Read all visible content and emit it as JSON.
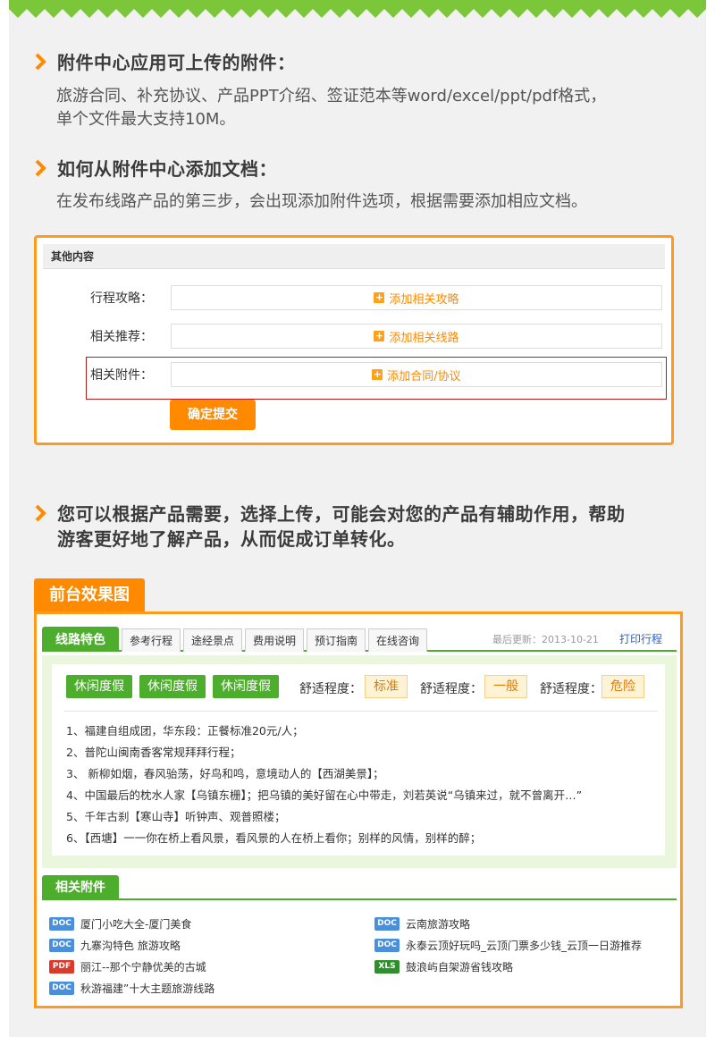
{
  "sections": [
    {
      "title": "附件中心应用可上传的附件：",
      "body": [
        "旅游合同、补充协议、产品PPT介绍、签证范本等word/excel/ppt/pdf格式，",
        "单个文件最大支持10M。"
      ]
    },
    {
      "title": "如何从附件中心添加文档：",
      "body": [
        "在发布线路产品的第三步，会出现添加附件选项，根据需要添加相应文档。"
      ]
    },
    {
      "title_lines": [
        "您可以根据产品需要，选择上传，可能会对您的产品有辅助作用，帮助",
        "游客更好地了解产品，从而促成订单转化。"
      ]
    }
  ],
  "form": {
    "header": "其他内容",
    "rows": [
      {
        "label": "行程攻略：",
        "action": "添加相关攻略"
      },
      {
        "label": "相关推荐：",
        "action": "添加相关线路"
      },
      {
        "label": "相关附件：",
        "action": "添加合同/协议"
      }
    ],
    "submit": "确定提交"
  },
  "preview": {
    "tag": "前台效果图",
    "tabs": [
      "线路特色",
      "参考行程",
      "途经景点",
      "费用说明",
      "预订指南",
      "在线咨询"
    ],
    "updated": "最后更新：2013-10-21",
    "print": "打印行程",
    "features": [
      "休闲度假",
      "休闲度假",
      "休闲度假"
    ],
    "comfort": [
      {
        "label": "舒适程度：",
        "value": "标准"
      },
      {
        "label": "舒适程度：",
        "value": "一般"
      },
      {
        "label": "舒适程度：",
        "value": "危险"
      }
    ],
    "itinerary": [
      "1、福建自组成团，华东段：正餐标准20元/人；",
      "2、普陀山闽南香客常规拜拜行程；",
      "3、 新柳如烟，春风骀荡，好鸟和鸣，意境动人的【西湖美景】；",
      "4、中国最后的枕水人家【乌镇东栅】；把乌镇的美好留在心中带走，刘若英说“乌镇来过，就不曾离开…”",
      "5、千年古刹【寒山寺】听钟声、观普照楼；",
      "6、【西塘】一一你在桥上看风景，看风景的人在桥上看你；别样的风情，别样的醉；"
    ],
    "attachments_title": "相关附件",
    "attachments": [
      {
        "type": "DOC",
        "name": "厦门小吃大全-厦门美食"
      },
      {
        "type": "DOC",
        "name": "云南旅游攻略"
      },
      {
        "type": "DOC",
        "name": "九寨沟特色 旅游攻略"
      },
      {
        "type": "DOC",
        "name": "永泰云顶好玩吗_云顶门票多少钱_云顶一日游推荐"
      },
      {
        "type": "PDF",
        "name": "丽江--那个宁静优美的古城"
      },
      {
        "type": "XLS",
        "name": "鼓浪屿自架游省钱攻略"
      },
      {
        "type": "DOC",
        "name": "秋游福建”十大主题旅游线路"
      }
    ]
  },
  "colors": {
    "accent": "#ff8a00",
    "green": "#4cae2c",
    "zigzag": "#7cc63a"
  }
}
